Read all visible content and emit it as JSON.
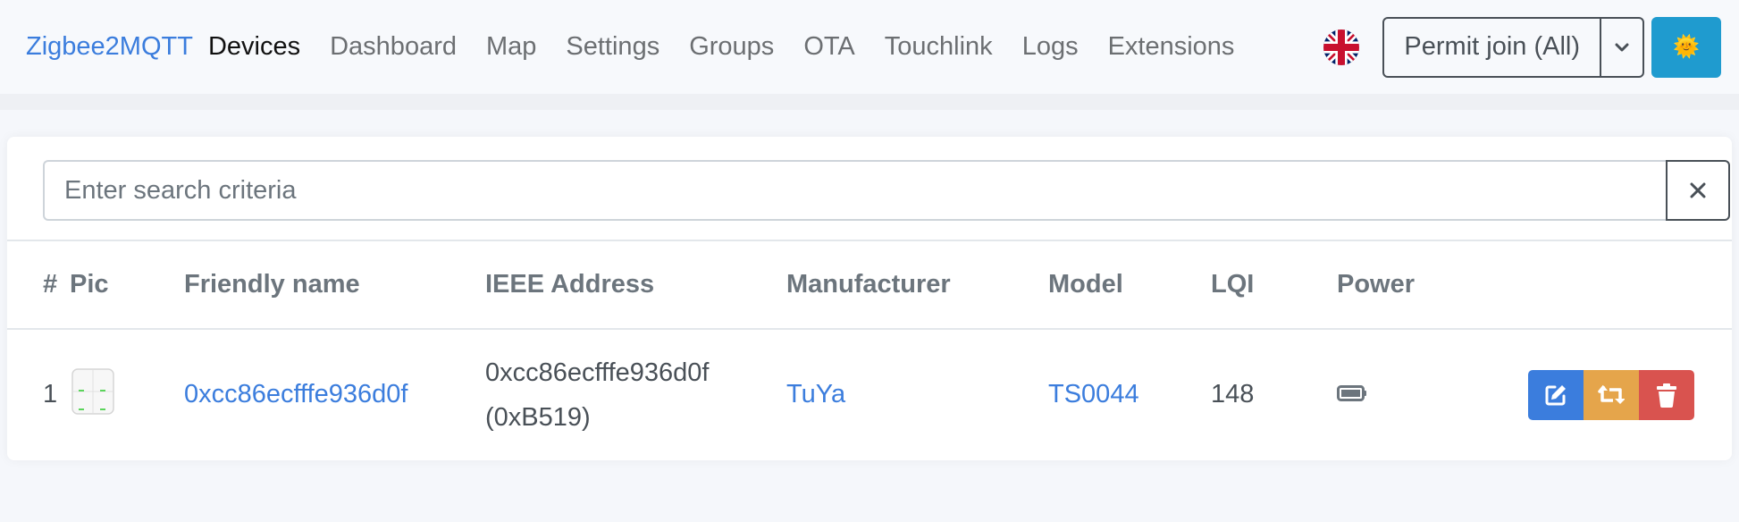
{
  "navbar": {
    "brand": "Zigbee2MQTT",
    "links": [
      {
        "label": "Devices",
        "active": true
      },
      {
        "label": "Dashboard"
      },
      {
        "label": "Map"
      },
      {
        "label": "Settings"
      },
      {
        "label": "Groups"
      },
      {
        "label": "OTA"
      },
      {
        "label": "Touchlink"
      },
      {
        "label": "Logs"
      },
      {
        "label": "Extensions"
      }
    ],
    "language_icon": "uk-flag-icon",
    "permit_join_label": "Permit join (All)",
    "permit_toggle_icon": "chevron-down-icon",
    "theme_icon": "sun-icon",
    "theme_glyph": "🌞"
  },
  "search": {
    "placeholder": "Enter search criteria",
    "value": "",
    "clear_glyph": "✕"
  },
  "table": {
    "columns": [
      "#",
      "Pic",
      "Friendly name",
      "IEEE Address",
      "Manufacturer",
      "Model",
      "LQI",
      "Power",
      ""
    ],
    "rows": [
      {
        "index": "1",
        "pic": "4-gang-switch-image",
        "friendly_name": "0xcc86ecfffe936d0f",
        "ieee_address": "0xcc86ecfffe936d0f",
        "network_address": "(0xB519)",
        "manufacturer": "TuYa",
        "model": "TS0044",
        "lqi": "148",
        "power": "battery",
        "actions": [
          "edit",
          "rename",
          "delete"
        ]
      }
    ]
  },
  "colors": {
    "brand": "#3b7ddd",
    "edit": "#3b7ddd",
    "rename": "#e5a54b",
    "delete": "#d9534f",
    "theme_button": "#1f9bcf"
  }
}
